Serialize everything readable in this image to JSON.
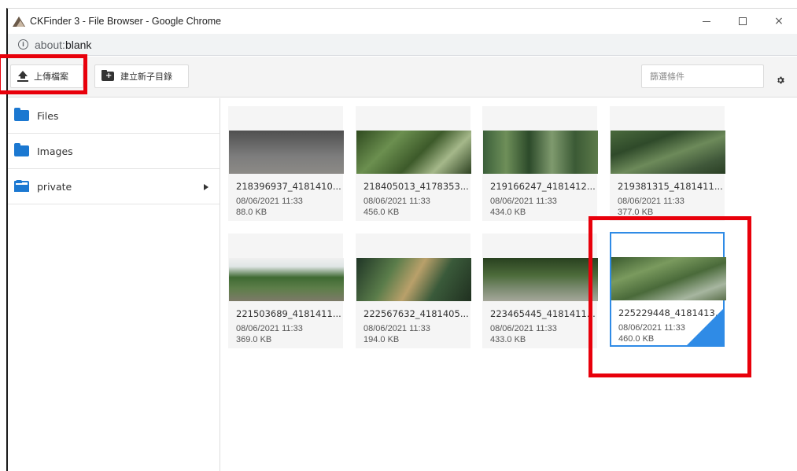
{
  "window": {
    "title": "CKFinder 3 - File Browser - Google Chrome",
    "controls": {
      "minimize": "minimize",
      "maximize": "maximize",
      "close": "×"
    }
  },
  "address": {
    "prefix": "about:",
    "host": "blank"
  },
  "toolbar": {
    "upload_label": "上傳檔案",
    "new_folder_label": "建立新子目錄",
    "filter_placeholder": "篩選條件"
  },
  "sidebar": {
    "items": [
      {
        "label": "Files",
        "icon": "folder-icon"
      },
      {
        "label": "Images",
        "icon": "folder-icon"
      },
      {
        "label": "private",
        "icon": "folder-open-icon",
        "has_children": true
      }
    ]
  },
  "files": [
    {
      "name": "218396937_4181410...",
      "date": "08/06/2021 11:33",
      "size": "88.0 KB"
    },
    {
      "name": "218405013_4178353...",
      "date": "08/06/2021 11:33",
      "size": "456.0 KB"
    },
    {
      "name": "219166247_4181412...",
      "date": "08/06/2021 11:33",
      "size": "434.0 KB"
    },
    {
      "name": "219381315_4181411...",
      "date": "08/06/2021 11:33",
      "size": "377.0 KB"
    },
    {
      "name": "221503689_4181411...",
      "date": "08/06/2021 11:33",
      "size": "369.0 KB"
    },
    {
      "name": "222567632_4181405...",
      "date": "08/06/2021 11:33",
      "size": "194.0 KB"
    },
    {
      "name": "223465445_4181411...",
      "date": "08/06/2021 11:33",
      "size": "433.0 KB"
    },
    {
      "name": "225229448_4181413...",
      "date": "08/06/2021 11:33",
      "size": "460.0 KB",
      "selected": true
    }
  ],
  "colors": {
    "accent": "#2f8be6",
    "folder": "#1b78d1",
    "highlight": "#e8000b"
  }
}
